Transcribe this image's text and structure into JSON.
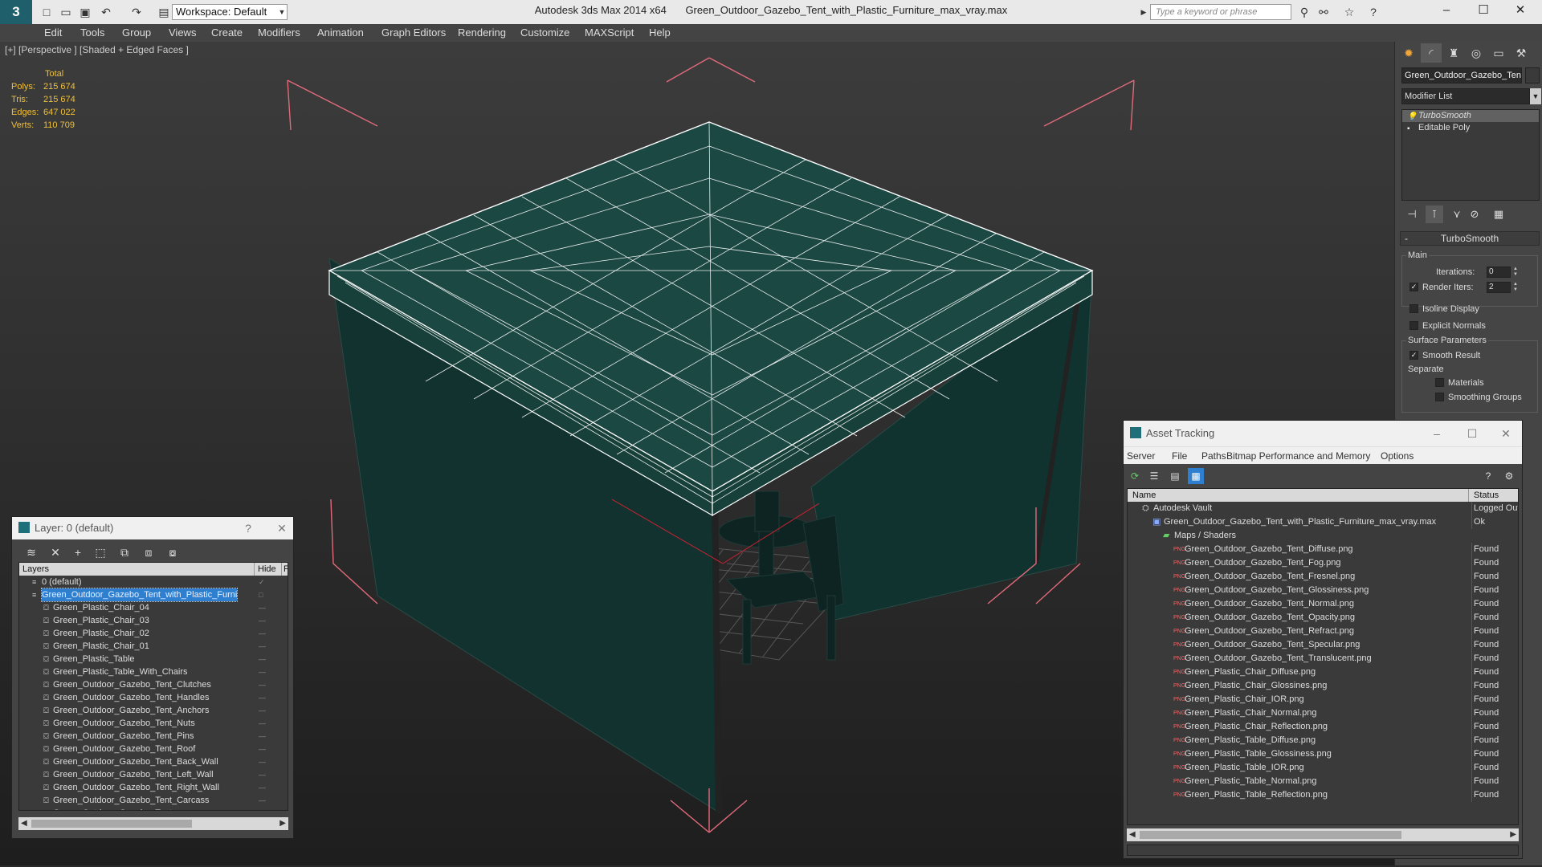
{
  "titlebar": {
    "app_name": "Autodesk 3ds Max  2014 x64",
    "file_name": "Green_Outdoor_Gazebo_Tent_with_Plastic_Furniture_max_vray.max",
    "workspace": "Workspace: Default",
    "search_placeholder": "Type a keyword or phrase"
  },
  "menu": [
    "Edit",
    "Tools",
    "Group",
    "Views",
    "Create",
    "Modifiers",
    "Animation",
    "Graph Editors",
    "Rendering",
    "Customize",
    "MAXScript",
    "Help"
  ],
  "viewport": {
    "label": "[+] [Perspective ] [Shaded + Edged Faces ]",
    "stats_header": "Total",
    "stats": [
      {
        "label": "Polys:",
        "value": "215 674"
      },
      {
        "label": "Tris:",
        "value": "215 674"
      },
      {
        "label": "Edges:",
        "value": "647 022"
      },
      {
        "label": "Verts:",
        "value": "110 709"
      }
    ],
    "colors": {
      "bbox": "#e06a7a",
      "wire": "#ffffff",
      "fabric": "#103a36",
      "fabric_light": "#1d4c46"
    }
  },
  "command_panel": {
    "object_name": "Green_Outdoor_Gazebo_Tent",
    "modifier_list": "Modifier List",
    "stack": [
      "TurboSmooth",
      "Editable Poly"
    ],
    "rollout_title": "TurboSmooth",
    "main_group": "Main",
    "iterations_label": "Iterations:",
    "iterations_value": "0",
    "render_iters_label": "Render Iters:",
    "render_iters_value": "2",
    "isoline_label": "Isoline Display",
    "explicit_normals_label": "Explicit Normals",
    "surface_group": "Surface Parameters",
    "smooth_result_label": "Smooth Result",
    "separate_label": "Separate",
    "materials_label": "Materials",
    "smoothing_groups_label": "Smoothing Groups"
  },
  "layer_dialog": {
    "title": "Layer: 0 (default)",
    "help": "?",
    "col_layers": "Layers",
    "col_hide": "Hide",
    "col_f": "F",
    "rows": [
      {
        "name": "0 (default)",
        "level": 0,
        "kind": "layer"
      },
      {
        "name": "Green_Outdoor_Gazebo_Tent_with_Plastic_Furni",
        "level": 0,
        "kind": "layer",
        "selected": true
      },
      {
        "name": "Green_Plastic_Chair_04",
        "level": 1,
        "kind": "object"
      },
      {
        "name": "Green_Plastic_Chair_03",
        "level": 1,
        "kind": "object"
      },
      {
        "name": "Green_Plastic_Chair_02",
        "level": 1,
        "kind": "object"
      },
      {
        "name": "Green_Plastic_Chair_01",
        "level": 1,
        "kind": "object"
      },
      {
        "name": "Green_Plastic_Table",
        "level": 1,
        "kind": "object"
      },
      {
        "name": "Green_Plastic_Table_With_Chairs",
        "level": 1,
        "kind": "object"
      },
      {
        "name": "Green_Outdoor_Gazebo_Tent_Clutches",
        "level": 1,
        "kind": "object"
      },
      {
        "name": "Green_Outdoor_Gazebo_Tent_Handles",
        "level": 1,
        "kind": "object"
      },
      {
        "name": "Green_Outdoor_Gazebo_Tent_Anchors",
        "level": 1,
        "kind": "object"
      },
      {
        "name": "Green_Outdoor_Gazebo_Tent_Nuts",
        "level": 1,
        "kind": "object"
      },
      {
        "name": "Green_Outdoor_Gazebo_Tent_Pins",
        "level": 1,
        "kind": "object"
      },
      {
        "name": "Green_Outdoor_Gazebo_Tent_Roof",
        "level": 1,
        "kind": "object"
      },
      {
        "name": "Green_Outdoor_Gazebo_Tent_Back_Wall",
        "level": 1,
        "kind": "object"
      },
      {
        "name": "Green_Outdoor_Gazebo_Tent_Left_Wall",
        "level": 1,
        "kind": "object"
      },
      {
        "name": "Green_Outdoor_Gazebo_Tent_Right_Wall",
        "level": 1,
        "kind": "object"
      },
      {
        "name": "Green_Outdoor_Gazebo_Tent_Carcass",
        "level": 1,
        "kind": "object"
      },
      {
        "name": "Green_Outdoor_Gazebo_Tent",
        "level": 1,
        "kind": "object"
      }
    ]
  },
  "asset_dialog": {
    "title": "Asset Tracking",
    "menu": [
      "Server",
      "File",
      "Paths",
      "Bitmap Performance and Memory",
      "Options"
    ],
    "col_name": "Name",
    "col_status": "Status",
    "rows": [
      {
        "name": "Autodesk Vault",
        "status": "Logged Out",
        "level": 0,
        "kind": "vault"
      },
      {
        "name": "Green_Outdoor_Gazebo_Tent_with_Plastic_Furniture_max_vray.max",
        "status": "Ok",
        "level": 1,
        "kind": "max"
      },
      {
        "name": "Maps / Shaders",
        "status": "",
        "level": 2,
        "kind": "folder"
      },
      {
        "name": "Green_Outdoor_Gazebo_Tent_Diffuse.png",
        "status": "Found",
        "level": 3,
        "kind": "png"
      },
      {
        "name": "Green_Outdoor_Gazebo_Tent_Fog.png",
        "status": "Found",
        "level": 3,
        "kind": "png"
      },
      {
        "name": "Green_Outdoor_Gazebo_Tent_Fresnel.png",
        "status": "Found",
        "level": 3,
        "kind": "png"
      },
      {
        "name": "Green_Outdoor_Gazebo_Tent_Glossiness.png",
        "status": "Found",
        "level": 3,
        "kind": "png"
      },
      {
        "name": "Green_Outdoor_Gazebo_Tent_Normal.png",
        "status": "Found",
        "level": 3,
        "kind": "png"
      },
      {
        "name": "Green_Outdoor_Gazebo_Tent_Opacity.png",
        "status": "Found",
        "level": 3,
        "kind": "png"
      },
      {
        "name": "Green_Outdoor_Gazebo_Tent_Refract.png",
        "status": "Found",
        "level": 3,
        "kind": "png"
      },
      {
        "name": "Green_Outdoor_Gazebo_Tent_Specular.png",
        "status": "Found",
        "level": 3,
        "kind": "png"
      },
      {
        "name": "Green_Outdoor_Gazebo_Tent_Translucent.png",
        "status": "Found",
        "level": 3,
        "kind": "png"
      },
      {
        "name": "Green_Plastic_Chair_Diffuse.png",
        "status": "Found",
        "level": 3,
        "kind": "png"
      },
      {
        "name": "Green_Plastic_Chair_Glossines.png",
        "status": "Found",
        "level": 3,
        "kind": "png"
      },
      {
        "name": "Green_Plastic_Chair_IOR.png",
        "status": "Found",
        "level": 3,
        "kind": "png"
      },
      {
        "name": "Green_Plastic_Chair_Normal.png",
        "status": "Found",
        "level": 3,
        "kind": "png"
      },
      {
        "name": "Green_Plastic_Chair_Reflection.png",
        "status": "Found",
        "level": 3,
        "kind": "png"
      },
      {
        "name": "Green_Plastic_Table_Diffuse.png",
        "status": "Found",
        "level": 3,
        "kind": "png"
      },
      {
        "name": "Green_Plastic_Table_Glossiness.png",
        "status": "Found",
        "level": 3,
        "kind": "png"
      },
      {
        "name": "Green_Plastic_Table_IOR.png",
        "status": "Found",
        "level": 3,
        "kind": "png"
      },
      {
        "name": "Green_Plastic_Table_Normal.png",
        "status": "Found",
        "level": 3,
        "kind": "png"
      },
      {
        "name": "Green_Plastic_Table_Reflection.png",
        "status": "Found",
        "level": 3,
        "kind": "png"
      }
    ]
  }
}
